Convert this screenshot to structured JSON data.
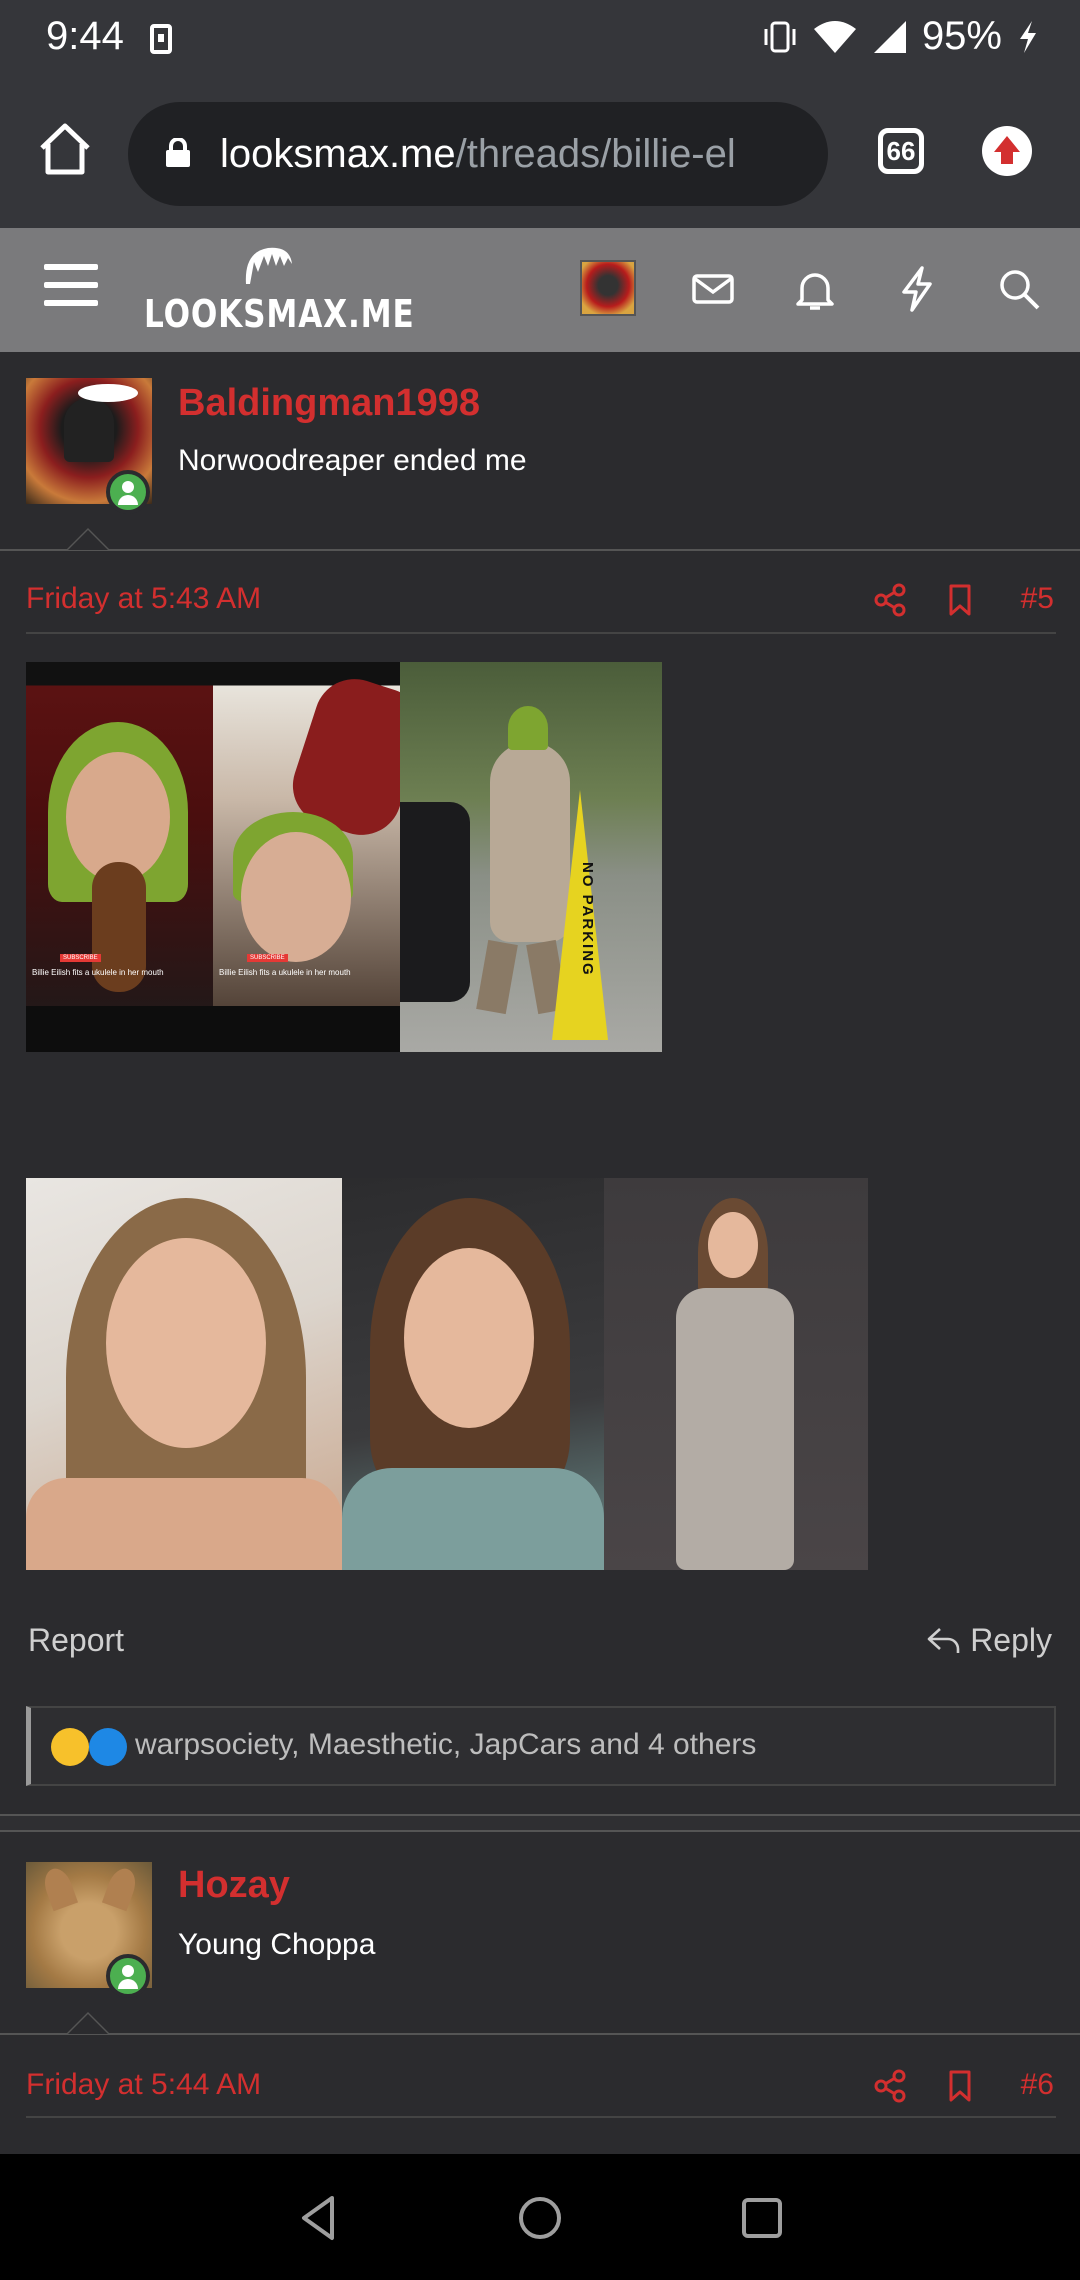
{
  "status_bar": {
    "time": "9:44",
    "battery": "95%"
  },
  "browser": {
    "url_domain": "looksmax.me",
    "url_path": "/threads/billie-el",
    "tab_count": "66"
  },
  "site": {
    "logo_text": "LOOKSMAX.ME"
  },
  "posts": [
    {
      "username": "Baldingman1998",
      "user_title": "Norwoodreaper ended me",
      "date": "Friday at 5:43 AM",
      "number": "#5",
      "tiktok_caption": "Billie Eilish fits a ukulele in her mouth",
      "subscribe_label": "SUBSCRIBE",
      "cone_text": "NO PARKING",
      "report_label": "Report",
      "reply_label": "Reply",
      "reactions_text": "warpsociety, Maesthetic, JapCars and 4 others"
    },
    {
      "username": "Hozay",
      "user_title": "Young Choppa",
      "date": "Friday at 5:44 AM",
      "number": "#6"
    }
  ],
  "colors": {
    "accent": "#d32f2f",
    "background": "#2b2b2e",
    "header": "#7a7a7c",
    "online": "#4caf50"
  },
  "icons": [
    "home-icon",
    "lock-icon",
    "tabs-icon",
    "update-icon",
    "hamburger-icon",
    "mail-icon",
    "bell-icon",
    "bolt-icon",
    "search-icon",
    "share-icon",
    "bookmark-icon",
    "reply-icon",
    "back-nav-icon",
    "home-nav-icon",
    "recents-nav-icon"
  ]
}
